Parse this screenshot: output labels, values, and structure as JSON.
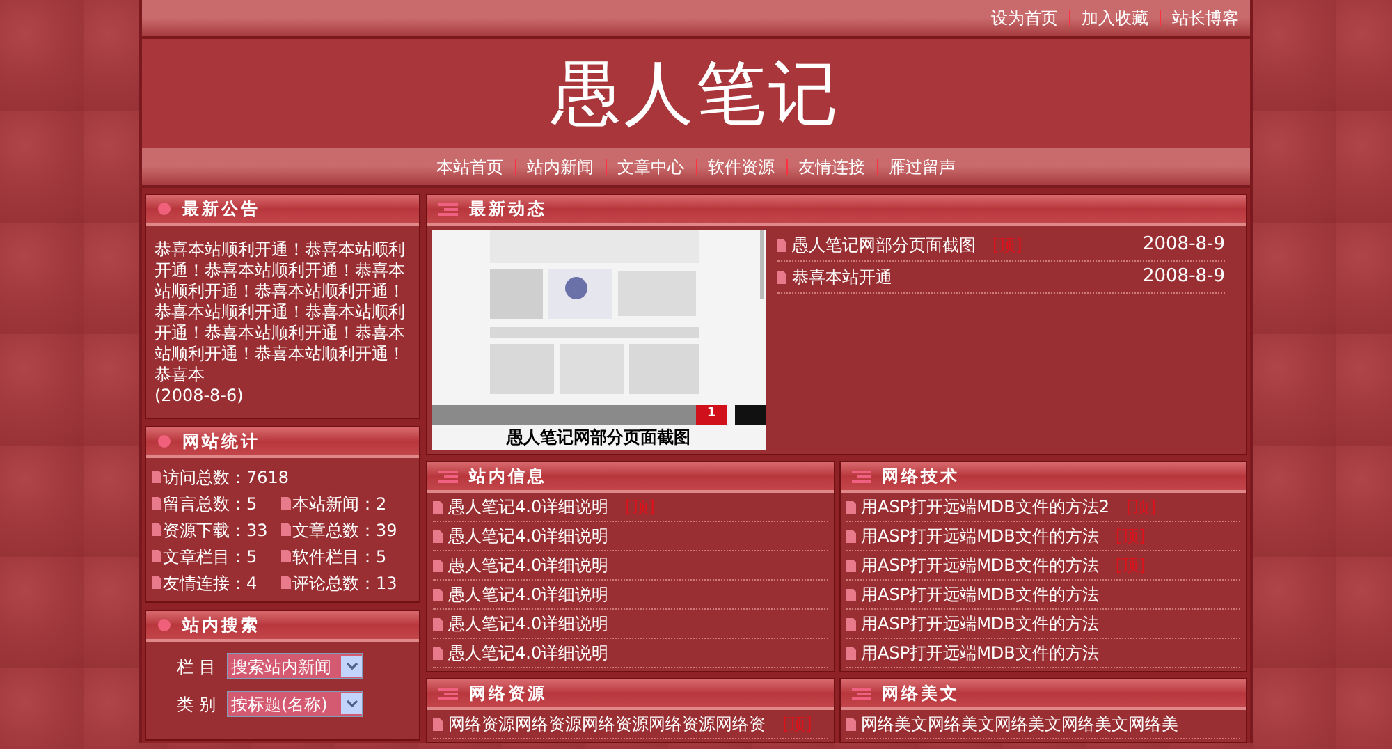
{
  "top_links": [
    "设为首页",
    "加入收藏",
    "站长博客"
  ],
  "site_title": "愚人笔记",
  "nav": [
    "本站首页",
    "站内新闻",
    "文章中心",
    "软件资源",
    "友情连接",
    "雁过留声"
  ],
  "notice": {
    "title": "最新公告",
    "text": "恭喜本站顺利开通！恭喜本站顺利开通！恭喜本站顺利开通！恭喜本站顺利开通！恭喜本站顺利开通！恭喜本站顺利开通！恭喜本站顺利开通！恭喜本站顺利开通！恭喜本站顺利开通！恭喜本站顺利开通！恭喜本",
    "date": "(2008-8-6)"
  },
  "stats": {
    "title": "网站统计",
    "rows": [
      [
        "访问总数：7618"
      ],
      [
        "留言总数：5",
        "本站新闻：2"
      ],
      [
        "资源下载：33",
        "文章总数：39"
      ],
      [
        "文章栏目：5",
        "软件栏目：5"
      ],
      [
        "友情连接：4",
        "评论总数：13"
      ]
    ]
  },
  "search": {
    "title": "站内搜索",
    "fields": [
      {
        "label": "栏 目",
        "value": "搜索站内新闻"
      },
      {
        "label": "类 别",
        "value": "按标题(名称)"
      }
    ]
  },
  "latest": {
    "title": "最新动态",
    "caption": "愚人笔记网部分页面截图",
    "slide_number": "1",
    "items": [
      {
        "title": "愚人笔记网部分页面截图",
        "tag": "[顶]",
        "date": "2008-8-9"
      },
      {
        "title": "恭喜本站开通",
        "date": "2008-8-9"
      }
    ]
  },
  "sections": [
    {
      "title": "站内信息",
      "items": [
        {
          "title": "愚人笔记4.0详细说明",
          "tag": "[顶]"
        },
        {
          "title": "愚人笔记4.0详细说明"
        },
        {
          "title": "愚人笔记4.0详细说明"
        },
        {
          "title": "愚人笔记4.0详细说明"
        },
        {
          "title": "愚人笔记4.0详细说明"
        },
        {
          "title": "愚人笔记4.0详细说明"
        }
      ]
    },
    {
      "title": "网络技术",
      "items": [
        {
          "title": "用ASP打开远端MDB文件的方法2",
          "tag": "[顶]"
        },
        {
          "title": "用ASP打开远端MDB文件的方法",
          "tag": "[顶]"
        },
        {
          "title": "用ASP打开远端MDB文件的方法",
          "tag": "[顶]"
        },
        {
          "title": "用ASP打开远端MDB文件的方法"
        },
        {
          "title": "用ASP打开远端MDB文件的方法"
        },
        {
          "title": "用ASP打开远端MDB文件的方法"
        }
      ]
    },
    {
      "title": "网络资源",
      "items": [
        {
          "title": "网络资源网络资源网络资源网络资源网络资",
          "tag": "[顶]"
        }
      ]
    },
    {
      "title": "网络美文",
      "items": [
        {
          "title": "网络美文网络美文网络美文网络美文网络美"
        }
      ]
    }
  ]
}
